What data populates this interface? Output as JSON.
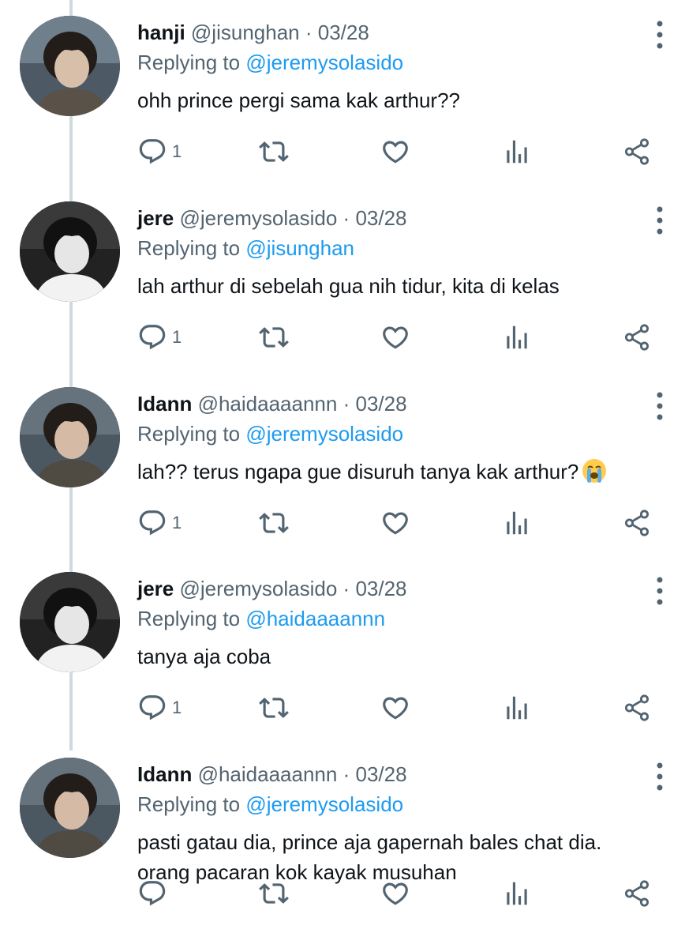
{
  "tweets": [
    {
      "name": "hanji",
      "handle": "@jisunghan",
      "separator": "·",
      "date": "03/28",
      "replying_prefix": "Replying to",
      "replying_to": "@jeremysolasido",
      "text": "ohh prince pergi sama kak arthur??",
      "reply_count": "1",
      "avatar_icon": "profile-photo-hanji"
    },
    {
      "name": "jere",
      "handle": "@jeremysolasido",
      "separator": "·",
      "date": "03/28",
      "replying_prefix": "Replying to",
      "replying_to": "@jisunghan",
      "text": "lah arthur di sebelah gua nih tidur, kita di kelas",
      "reply_count": "1",
      "avatar_icon": "profile-photo-jere"
    },
    {
      "name": "Idann",
      "handle": "@haidaaaannn",
      "separator": "·",
      "date": "03/28",
      "replying_prefix": "Replying to",
      "replying_to": "@jeremysolasido",
      "text": "lah?? terus ngapa gue disuruh tanya kak arthur?",
      "emoji": "loudly-crying-face",
      "reply_count": "1",
      "avatar_icon": "profile-photo-idann"
    },
    {
      "name": "jere",
      "handle": "@jeremysolasido",
      "separator": "·",
      "date": "03/28",
      "replying_prefix": "Replying to",
      "replying_to": "@haidaaaannn",
      "text": "tanya aja coba",
      "reply_count": "1",
      "avatar_icon": "profile-photo-jere"
    },
    {
      "name": "Idann",
      "handle": "@haidaaaannn",
      "separator": "·",
      "date": "03/28",
      "replying_prefix": "Replying to",
      "replying_to": "@jeremysolasido",
      "text_line1": "pasti gatau dia, prince aja gapernah bales chat dia.",
      "text_line2": "orang pacaran kok kayak musuhan",
      "reply_count": "",
      "avatar_icon": "profile-photo-idann"
    }
  ],
  "colors": {
    "accent": "#1d9bf0",
    "secondary_text": "#536471",
    "primary_text": "#0f1419",
    "thread_line": "#cfd9de"
  },
  "icons": [
    "reply-icon",
    "retweet-icon",
    "like-icon",
    "views-icon",
    "share-icon",
    "more-icon"
  ]
}
